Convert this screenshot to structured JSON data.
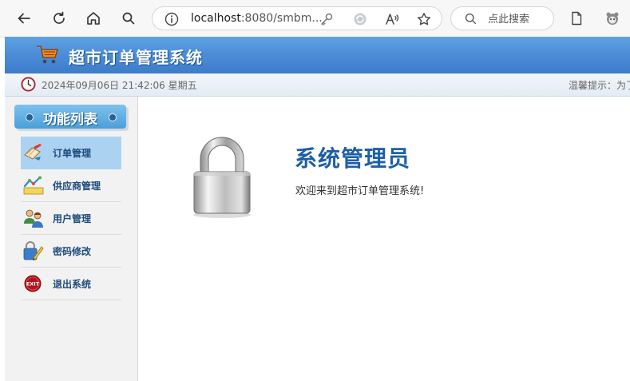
{
  "browser": {
    "url_host": "localhost",
    "url_rest": ":8080/smbm...",
    "search_placeholder": "点此搜索",
    "icons": [
      "back-icon",
      "refresh-icon",
      "home-icon",
      "search-icon",
      "info-icon",
      "key-icon",
      "sync-icon",
      "read-aloud-icon",
      "favorite-icon",
      "search-icon",
      "reading-view-icon",
      "extension-icon"
    ]
  },
  "header": {
    "title": "超市订单管理系统",
    "icon": "cart-icon",
    "bg_color": "#4a8ad6"
  },
  "status_bar": {
    "datetime": "2024年09月06日 21:42:06 星期五",
    "tip": "温馨提示：为了"
  },
  "sidebar": {
    "title": "功能列表",
    "items": [
      {
        "label": "订单管理",
        "icon": "order-icon",
        "active": true
      },
      {
        "label": "供应商管理",
        "icon": "supplier-icon",
        "active": false
      },
      {
        "label": "用户管理",
        "icon": "users-icon",
        "active": false
      },
      {
        "label": "密码修改",
        "icon": "password-icon",
        "active": false
      },
      {
        "label": "退出系统",
        "icon": "exit-icon",
        "active": false
      }
    ],
    "exit_badge": "EXIT"
  },
  "main": {
    "role_title": "系统管理员",
    "welcome": "欢迎来到超市订单管理系统!"
  }
}
